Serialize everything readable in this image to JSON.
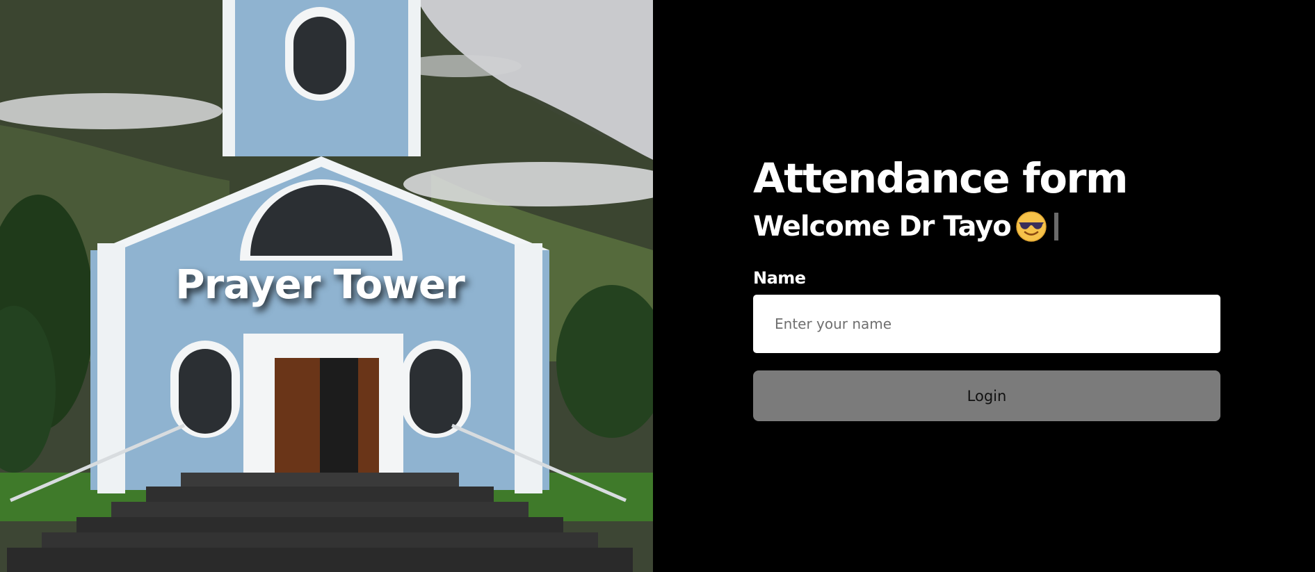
{
  "hero": {
    "title": "Prayer Tower",
    "image": "church-photo"
  },
  "form": {
    "title": "Attendance form",
    "welcome": "Welcome Dr Tayo",
    "welcome_emoji": "smiling-face-with-sunglasses-icon",
    "name_label": "Name",
    "name_placeholder": "Enter your name",
    "name_value": "",
    "login_label": "Login"
  },
  "colors": {
    "panel_background": "#000000",
    "button_background": "#7b7b7b",
    "input_background": "#ffffff",
    "church_blue": "#8fb3d0"
  }
}
